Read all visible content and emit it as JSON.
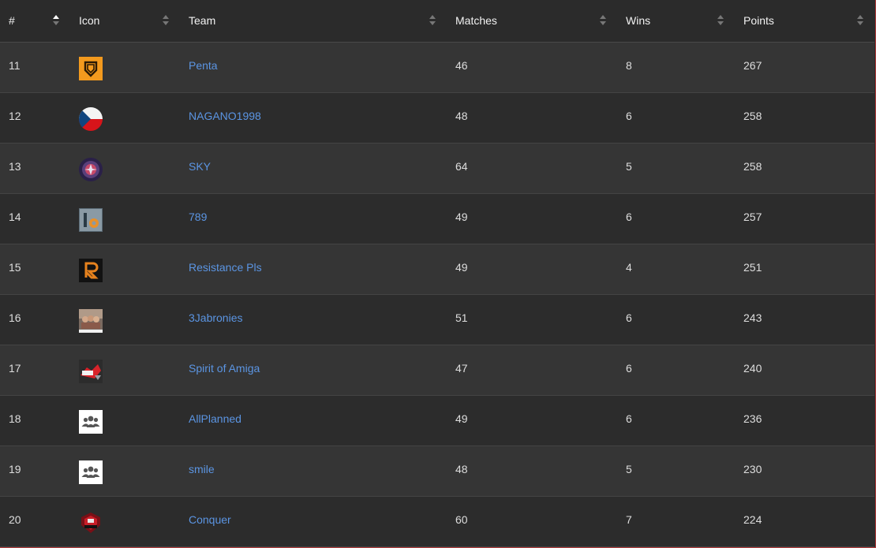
{
  "table": {
    "columns": [
      {
        "key": "rank",
        "label": "#",
        "sort_active": true
      },
      {
        "key": "icon",
        "label": "Icon",
        "sort_active": false
      },
      {
        "key": "team",
        "label": "Team",
        "sort_active": false
      },
      {
        "key": "matches",
        "label": "Matches",
        "sort_active": false
      },
      {
        "key": "wins",
        "label": "Wins",
        "sort_active": false
      },
      {
        "key": "points",
        "label": "Points",
        "sort_active": false
      }
    ],
    "rows": [
      {
        "rank": "11",
        "icon": "penta-logo-icon",
        "team": "Penta",
        "matches": "46",
        "wins": "8",
        "points": "267"
      },
      {
        "rank": "12",
        "icon": "czech-flag-icon",
        "team": "NAGANO1998",
        "matches": "48",
        "wins": "6",
        "points": "258"
      },
      {
        "rank": "13",
        "icon": "sky-badge-icon",
        "team": "SKY",
        "matches": "64",
        "wins": "5",
        "points": "258"
      },
      {
        "rank": "14",
        "icon": "789-logo-icon",
        "team": "789",
        "matches": "49",
        "wins": "6",
        "points": "257"
      },
      {
        "rank": "15",
        "icon": "resistance-r-logo-icon",
        "team": "Resistance Pls",
        "matches": "49",
        "wins": "4",
        "points": "251"
      },
      {
        "rank": "16",
        "icon": "3jabronies-photo-icon",
        "team": "3Jabronies",
        "matches": "51",
        "wins": "6",
        "points": "243"
      },
      {
        "rank": "17",
        "icon": "spirit-of-amiga-logo-icon",
        "team": "Spirit of Amiga",
        "matches": "47",
        "wins": "6",
        "points": "240"
      },
      {
        "rank": "18",
        "icon": "team-group-placeholder-icon",
        "team": "AllPlanned",
        "matches": "49",
        "wins": "6",
        "points": "236"
      },
      {
        "rank": "19",
        "icon": "team-group-placeholder-icon",
        "team": "smile",
        "matches": "48",
        "wins": "5",
        "points": "230"
      },
      {
        "rank": "20",
        "icon": "conquer-logo-icon",
        "team": "Conquer",
        "matches": "60",
        "wins": "7",
        "points": "224"
      }
    ]
  },
  "colors": {
    "link": "#5b95e3",
    "header_bg": "#2b2b2b",
    "row_odd_bg": "#353535",
    "row_even_bg": "#2c2c2c",
    "text": "#dedede",
    "accent_orange": "#f39a1e"
  }
}
